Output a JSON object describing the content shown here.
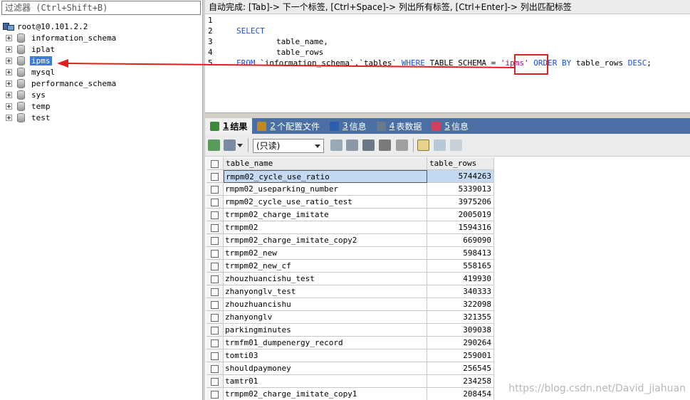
{
  "left_panel": {
    "filter_placeholder": "过滤器 (Ctrl+Shift+B)",
    "root_label": "root@10.101.2.2",
    "databases": [
      {
        "name": "information_schema",
        "selected": false
      },
      {
        "name": "iplat",
        "selected": false
      },
      {
        "name": "ipms",
        "selected": true
      },
      {
        "name": "mysql",
        "selected": false
      },
      {
        "name": "performance_schema",
        "selected": false
      },
      {
        "name": "sys",
        "selected": false
      },
      {
        "name": "temp",
        "selected": false
      },
      {
        "name": "test",
        "selected": false
      }
    ]
  },
  "editor": {
    "hint": "自动完成: [Tab]-> 下一个标签, [Ctrl+Space]-> 列出所有标签, [Ctrl+Enter]-> 列出匹配标签",
    "line_numbers": [
      "1",
      "2",
      "3",
      "4",
      "5"
    ],
    "line2_kw": "SELECT",
    "line3": "table_name,",
    "line4": "table_rows",
    "line5_from": "FROM",
    "line5_table": " `information_schema`.`tables` ",
    "line5_where": "WHERE",
    "line5_col": " TABLE_SCHEMA = ",
    "line5_value": "'ipms'",
    "line5_order": " ORDER BY ",
    "line5_rows": "table_rows ",
    "line5_desc": "DESC",
    "line5_end": ";"
  },
  "tabs": [
    {
      "num": "1",
      "label": "结果",
      "color": "#3a8a3a",
      "active": true
    },
    {
      "num": "2",
      "label": "个配置文件",
      "color": "#c08a20",
      "active": false
    },
    {
      "num": "3",
      "label": "信息",
      "color": "#2a5fb0",
      "active": false
    },
    {
      "num": "4",
      "label": "表数据",
      "color": "#6a7a8a",
      "active": false
    },
    {
      "num": "5",
      "label": "信息",
      "color": "#d04060",
      "active": false
    }
  ],
  "toolbar": {
    "mode_value": "(只读)"
  },
  "grid": {
    "columns": [
      "table_name",
      "table_rows"
    ],
    "rows": [
      [
        "rmpm02_cycle_use_ratio",
        "5744263"
      ],
      [
        "rmpm02_useparking_number",
        "5339013"
      ],
      [
        "rmpm02_cycle_use_ratio_test",
        "3975206"
      ],
      [
        "trmpm02_charge_imitate",
        "2005019"
      ],
      [
        "trmpm02",
        "1594316"
      ],
      [
        "trmpm02_charge_imitate_copy2",
        "669090"
      ],
      [
        "trmpm02_new",
        "598413"
      ],
      [
        "trmpm02_new_cf",
        "558165"
      ],
      [
        "zhouzhuancishu_test",
        "419930"
      ],
      [
        "zhanyonglv_test",
        "340333"
      ],
      [
        "zhouzhuancishu",
        "322098"
      ],
      [
        "zhanyonglv",
        "321355"
      ],
      [
        "parkingminutes",
        "309038"
      ],
      [
        "trmfm01_dumpenergy_record",
        "290264"
      ],
      [
        "tomti03",
        "259001"
      ],
      [
        "shouldpaymoney",
        "256545"
      ],
      [
        "tamtr01",
        "234258"
      ],
      [
        "trmpm02_charge_imitate_copy1",
        "208454"
      ]
    ]
  },
  "watermark": "https://blog.csdn.net/David_jiahuan"
}
